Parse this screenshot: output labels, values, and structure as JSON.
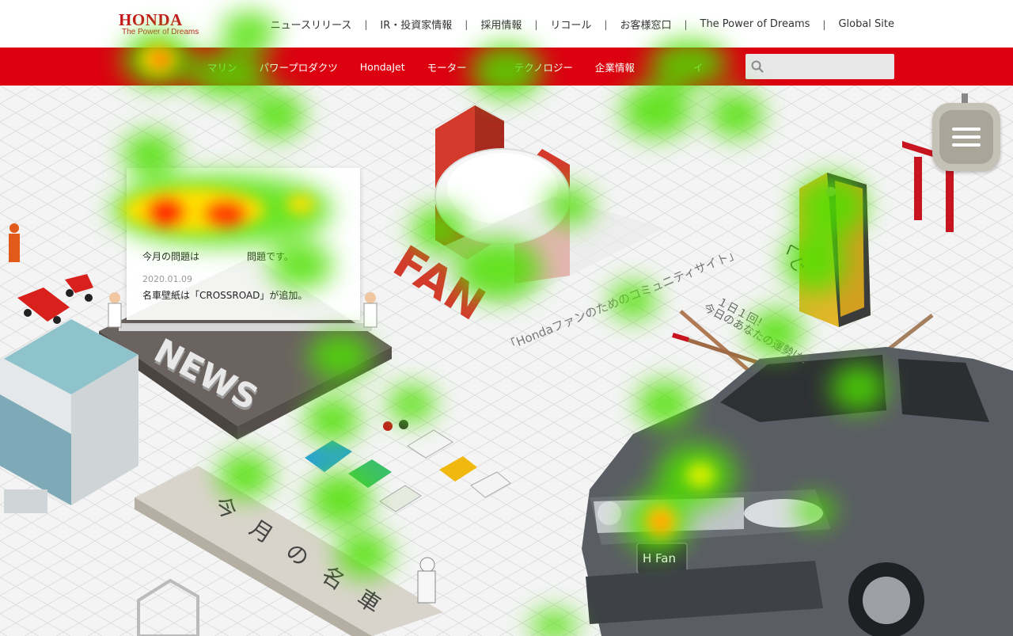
{
  "logo": {
    "name": "HONDA",
    "tagline": "The Power of Dreams"
  },
  "top_links": [
    "ニュースリリース",
    "IR・投資家情報",
    "採用情報",
    "リコール",
    "お客様窓口",
    "The Power of Dreams",
    "Global Site"
  ],
  "top_links_separator": "|",
  "nav_items": [
    "マリン",
    "パワープロダクツ",
    "HondaJet",
    "モーター",
    "テクノロジー",
    "企業情報"
  ],
  "nav_partial_label": "イ",
  "search": {
    "placeholder": ""
  },
  "news": {
    "items": [
      {
        "date": "",
        "text": "今月の問題は　　　　　問題です。"
      },
      {
        "date": "2020.01.09",
        "text": "名車壁紙は「CROSSROAD」が追加。"
      }
    ]
  },
  "scene_text": {
    "news_sign": "NEWS",
    "fan_sign": "FAN",
    "community_tagline": "「Hondaファンのためのコミュニティサイト」",
    "fortune_line1": "１日１回！",
    "fortune_line2": "今日のあなたの運勢は？",
    "omikuji_label": "くじ",
    "conveyor_label": "今月の名車",
    "car_badge": "H Fan"
  },
  "colors": {
    "brand_red": "#dc0010",
    "logo_red": "#c8141e"
  }
}
